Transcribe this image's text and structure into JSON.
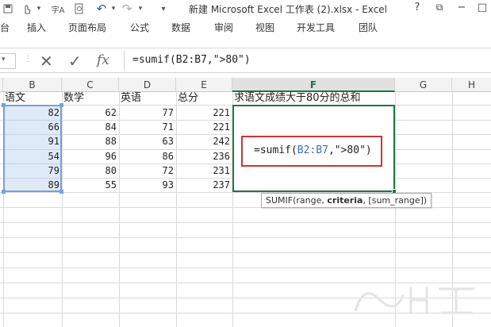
{
  "titlebar": {
    "title": "新建 Microsoft Excel 工作表 (2).xlsx - Excel",
    "help": "?",
    "restore": "⧉",
    "minimize": "−",
    "close": "□",
    "qat_icons": [
      "save-icon",
      "touch-mode-icon",
      "spelling-icon",
      "print-preview-icon",
      "undo-icon",
      "redo-icon",
      "customize-qat-icon"
    ],
    "spell_glyph": "字A",
    "undo_glyph": "↶",
    "redo_glyph": "↷",
    "more_glyph": "▾"
  },
  "ribbon": {
    "tabs": [
      "台",
      "插入",
      "页面布局",
      "公式",
      "数据",
      "审阅",
      "视图",
      "开发工具",
      "团队"
    ]
  },
  "formula_bar": {
    "cancel": "✕",
    "enter": "✓",
    "fx": "fx",
    "content": "=sumif(B2:B7,\">80\")"
  },
  "columns": [
    "B",
    "C",
    "D",
    "E",
    "F",
    "G",
    "H"
  ],
  "active_column": "F",
  "headers": {
    "B": "语文",
    "C": "数学",
    "D": "英语",
    "E": "总分",
    "F": "求语文成绩大于80分的总和"
  },
  "rows": [
    [
      "82",
      "62",
      "77",
      "221"
    ],
    [
      "66",
      "84",
      "71",
      "221"
    ],
    [
      "91",
      "88",
      "63",
      "242"
    ],
    [
      "54",
      "96",
      "86",
      "236"
    ],
    [
      "79",
      "80",
      "72",
      "231"
    ],
    [
      "89",
      "55",
      "93",
      "237"
    ]
  ],
  "cell_formula": {
    "prefix": "=sumif(",
    "ref": "B2:B7",
    "suffix": ",\">80\")"
  },
  "tooltip": {
    "fn": "SUMIF(",
    "arg1": "range, ",
    "arg2": "criteria",
    "arg3": ", [sum_range])"
  },
  "colors": {
    "excel_green": "#217346",
    "highlight_red": "#d93030",
    "ref_blue": "#3a6fc7"
  }
}
